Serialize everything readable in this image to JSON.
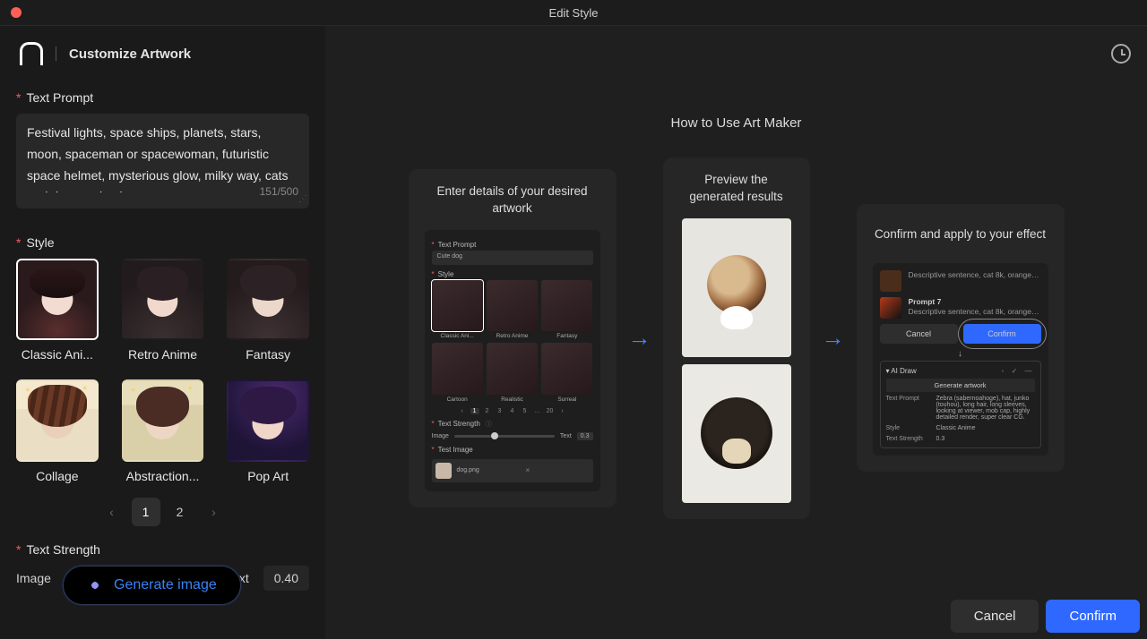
{
  "window": {
    "title": "Edit Style"
  },
  "sidebar": {
    "title": "Customize Artwork",
    "field_prompt_label": "Text Prompt",
    "prompt_value": "Festival lights, space ships, planets, stars, moon, spaceman or spacewoman, futuristic space helmet, mysterious glow, milky way, cats and dogs, animals",
    "prompt_counter": "151/500",
    "field_style_label": "Style",
    "field_strength_label": "Text Strength",
    "strength_image_label": "Image",
    "strength_text_label": "Text",
    "strength_value": "0.40"
  },
  "styles": [
    {
      "label": "Classic Ani...",
      "selected": true,
      "klass": "p-classic"
    },
    {
      "label": "Retro Anime",
      "selected": false,
      "klass": "p-retro"
    },
    {
      "label": "Fantasy",
      "selected": false,
      "klass": "p-fantasy"
    },
    {
      "label": "Collage",
      "selected": false,
      "klass": "p-collage"
    },
    {
      "label": "Abstraction...",
      "selected": false,
      "klass": "p-abstract"
    },
    {
      "label": "Pop Art",
      "selected": false,
      "klass": "p-pop"
    }
  ],
  "pager": {
    "pages": [
      "1",
      "2"
    ],
    "active": "1"
  },
  "generate_label": "Generate image",
  "main": {
    "title": "How to Use Art Maker",
    "card1": {
      "title": "Enter details of your desired artwork",
      "label_prompt": "Text Prompt",
      "input_value": "Cute dog",
      "label_style": "Style",
      "styles": [
        "Classic Ani...",
        "Retro Anime",
        "Fantasy",
        "Cartoon",
        "Realistic",
        "Surreal"
      ],
      "pager": [
        "‹",
        "1",
        "2",
        "3",
        "4",
        "5",
        "…",
        "20",
        "›"
      ],
      "label_strength": "Text Strength",
      "slider_left": "Image",
      "slider_right": "Text",
      "slider_value": "0.3",
      "label_test": "Test Image",
      "test_filename": "dog.png"
    },
    "card2": {
      "title": "Preview the generated results"
    },
    "card3": {
      "title": "Confirm and apply to your effect",
      "row1_desc": "Descriptive sentence, cat 8k, orange…",
      "row2_title": "Prompt 7",
      "row2_desc": "Descriptive sentence, cat 8k, orange…",
      "btn_cancel": "Cancel",
      "btn_confirm": "Confirm",
      "panel_title": "AI Draw",
      "panel_btn": "Generate artwork",
      "panel_rows": {
        "r1k": "Text Prompt",
        "r1v": "Zebra (sabernoahoge), hat, junko (touhou), long hair, long sleeves, looking at viewer, mob cap, highly detailed render, super clear CG.",
        "r2k": "Style",
        "r2v": "Classic Anime",
        "r3k": "Text Strength",
        "r3v": "0.3"
      }
    }
  },
  "footer": {
    "cancel": "Cancel",
    "confirm": "Confirm"
  }
}
